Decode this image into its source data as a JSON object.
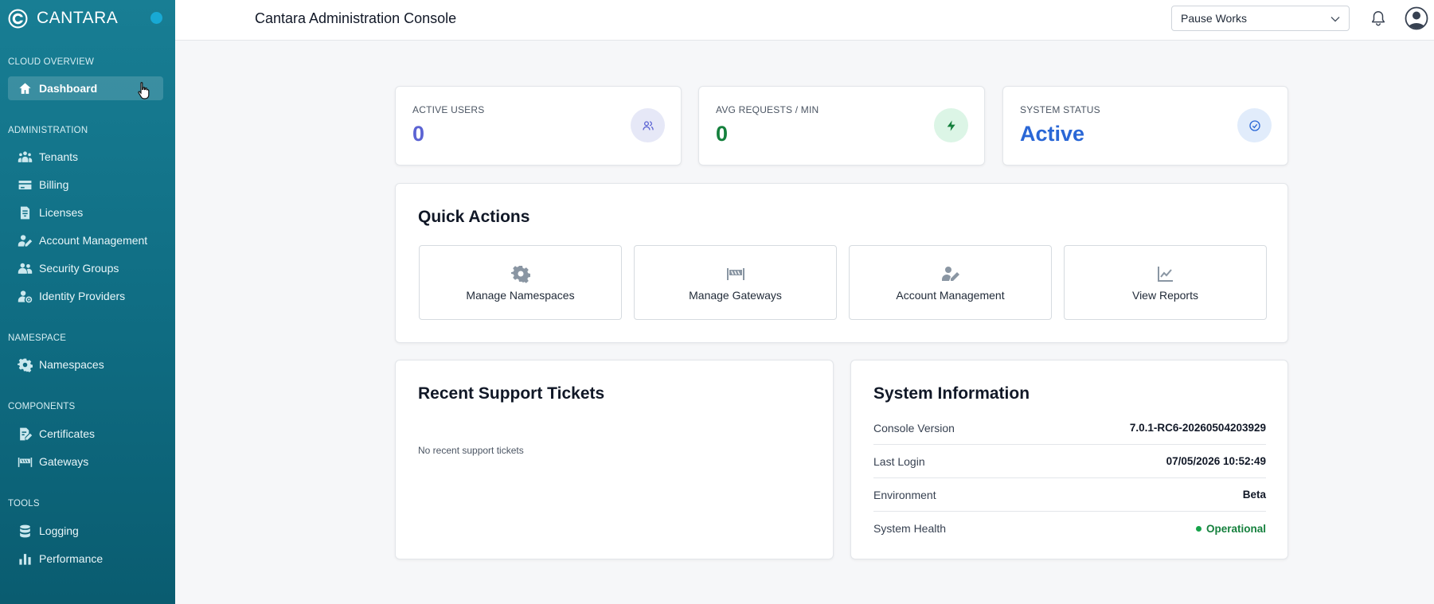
{
  "brand": {
    "name": "CANTARA"
  },
  "sidebar": {
    "sections": [
      {
        "title": "CLOUD OVERVIEW"
      },
      {
        "title": "ADMINISTRATION"
      },
      {
        "title": "NAMESPACE"
      },
      {
        "title": "COMPONENTS"
      },
      {
        "title": "TOOLS"
      }
    ],
    "items": [
      {
        "label": "Dashboard",
        "icon": "home-icon",
        "active": true
      },
      {
        "label": "Tenants",
        "icon": "tenants-icon"
      },
      {
        "label": "Billing",
        "icon": "billing-icon"
      },
      {
        "label": "Licenses",
        "icon": "license-icon"
      },
      {
        "label": "Account Management",
        "icon": "user-edit-icon"
      },
      {
        "label": "Security Groups",
        "icon": "users-icon"
      },
      {
        "label": "Identity Providers",
        "icon": "identity-icon"
      },
      {
        "label": "Namespaces",
        "icon": "gear-icon"
      },
      {
        "label": "Certificates",
        "icon": "certificate-icon"
      },
      {
        "label": "Gateways",
        "icon": "gateway-icon"
      },
      {
        "label": "Logging",
        "icon": "database-icon"
      },
      {
        "label": "Performance",
        "icon": "bar-chart-icon"
      }
    ]
  },
  "header": {
    "title": "Cantara Administration Console",
    "tenant_selector": {
      "value": "Pause Works"
    }
  },
  "stats": [
    {
      "label": "ACTIVE USERS",
      "value": "0",
      "color": "#5b63d3",
      "icon_bg": "#e6e8f7",
      "icon": "users-icon"
    },
    {
      "label": "AVG REQUESTS / MIN",
      "value": "0",
      "color": "#15803d",
      "icon_bg": "#dcf5e6",
      "icon": "bolt-icon"
    },
    {
      "label": "SYSTEM STATUS",
      "value": "Active",
      "color": "#2a67d6",
      "icon_bg": "#e1ecfb",
      "icon": "check-circle-icon"
    }
  ],
  "quick_actions": {
    "title": "Quick Actions",
    "items": [
      {
        "label": "Manage Namespaces",
        "icon": "gear-icon"
      },
      {
        "label": "Manage Gateways",
        "icon": "gateway-icon"
      },
      {
        "label": "Account Management",
        "icon": "user-edit-icon"
      },
      {
        "label": "View Reports",
        "icon": "line-chart-icon"
      }
    ]
  },
  "support": {
    "title": "Recent Support Tickets",
    "empty": "No recent support tickets"
  },
  "system_info": {
    "title": "System Information",
    "rows": [
      {
        "key": "Console Version",
        "value": "7.0.1-RC6-20260504203929"
      },
      {
        "key": "Last Login",
        "value": "07/05/2026 10:52:49"
      },
      {
        "key": "Environment",
        "value": "Beta"
      },
      {
        "key": "System Health",
        "value": "Operational",
        "status": "ok"
      }
    ]
  }
}
